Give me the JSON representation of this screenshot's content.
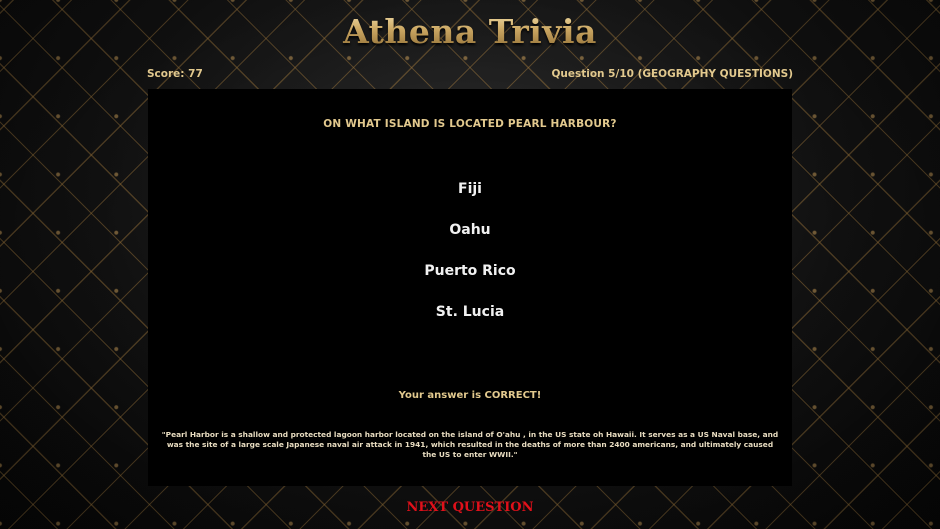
{
  "game": {
    "title": "Athena Trivia"
  },
  "status": {
    "score": "Score: 77",
    "question_counter": "Question 5/10 (GEOGRAPHY QUESTIONS)"
  },
  "question": {
    "text": "ON WHAT ISLAND IS LOCATED PEARL HARBOUR?",
    "answers": [
      {
        "label": "Fiji"
      },
      {
        "label": "Oahu"
      },
      {
        "label": "Puerto Rico"
      },
      {
        "label": "St. Lucia"
      }
    ]
  },
  "feedback": {
    "result": "Your answer is CORRECT!",
    "explanation": "\"Pearl Harbor is a shallow and protected lagoon harbor located on the island of O'ahu , in the US state oh Hawaii. It serves as a US Naval base, and was the site of a large scale Japanese naval air attack in 1941, which resulted in the deaths of more than 2400 americans, and ultimately caused the US to enter WWII.\""
  },
  "controls": {
    "next_label": "NEXT QUESTION"
  },
  "colors": {
    "gold": "#e2c98e",
    "next_red": "#e0101a",
    "panel": "#000000"
  }
}
